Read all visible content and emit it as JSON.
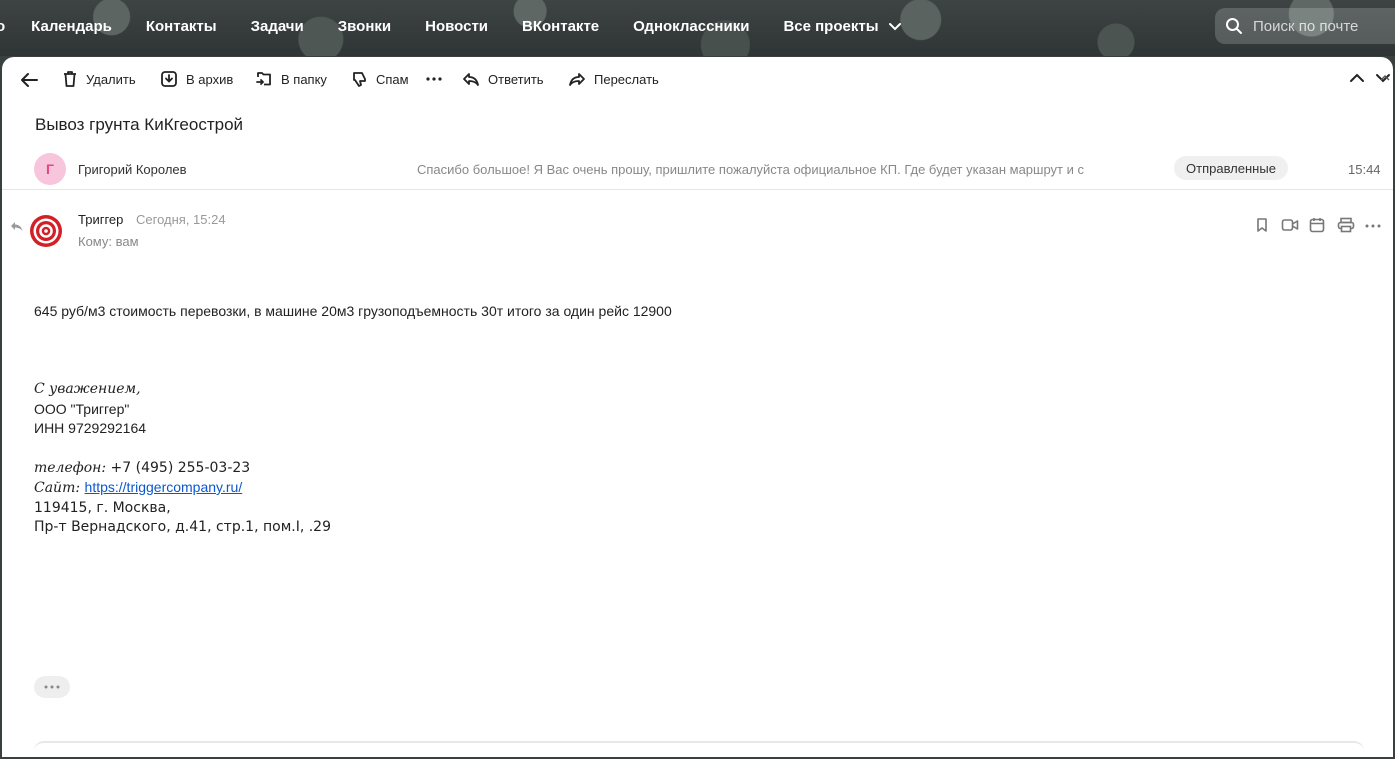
{
  "nav": {
    "items": [
      "о",
      "Календарь",
      "Контакты",
      "Задачи",
      "Звонки",
      "Новости",
      "ВКонтакте",
      "Одноклассники",
      "Все проекты"
    ],
    "search_placeholder": "Поиск по почте"
  },
  "toolbar": {
    "delete": "Удалить",
    "archive": "В архив",
    "to_folder": "В папку",
    "spam": "Спам",
    "reply": "Ответить",
    "forward": "Переслать"
  },
  "subject": "Вывоз грунта КиКгеострой",
  "thread": {
    "avatar_letter": "Г",
    "sender": "Григорий Королев",
    "snippet": "Спасибо большое! Я Вас очень прошу, пришлите пожалуйста официальное КП. Где будет указан маршрут и с",
    "folder": "Отправленные",
    "time": "15:44"
  },
  "message": {
    "from": "Триггер",
    "date": "Сегодня, 15:24",
    "to": "Кому: вам",
    "body": "645 руб/м3 стоимость перевозки, в машине 20м3 грузоподъемность 30т итого за один рейс 12900",
    "signature": {
      "greeting": "С уважением,",
      "company": "ООО \"Триггер\"",
      "inn": "ИНН 9729292164",
      "phone_label": "телефон: ",
      "phone": "+7 (495) 255-03-23",
      "site_label": "Сайт: ",
      "site_url": "https://triggercompany.ru/",
      "address1": "119415, г. Москва,",
      "address2": "Пр-т Вернадского, д.41, стр.1, пом.I, .29"
    }
  },
  "colors": {
    "accent_red": "#d32027",
    "avatar_pink_bg": "#f7c6dc",
    "avatar_pink_fg": "#e5467f",
    "link": "#0b57d0"
  }
}
